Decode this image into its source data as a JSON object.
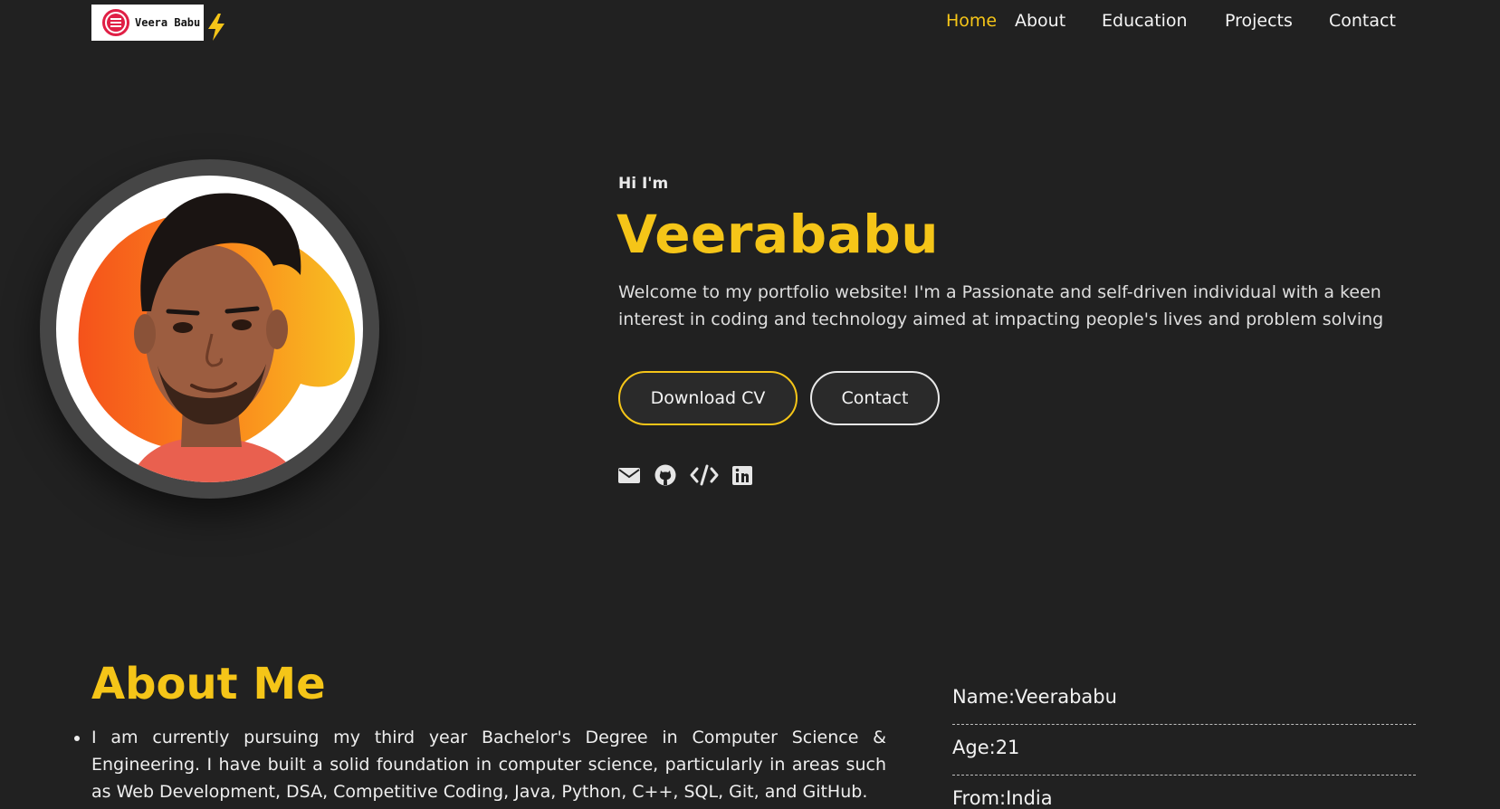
{
  "logo": {
    "text": "Veera Babu"
  },
  "nav": {
    "items": [
      {
        "label": "Home",
        "active": true
      },
      {
        "label": "About"
      },
      {
        "label": "Education"
      },
      {
        "label": "Projects"
      },
      {
        "label": "Contact"
      }
    ]
  },
  "hero": {
    "greeting": "Hi I'm",
    "name": "Veerababu",
    "description": "Welcome to my portfolio website! I'm a Passionate and self-driven individual with a keen interest in coding and technology aimed at impacting people's lives and problem solving",
    "buttons": {
      "download_cv": "Download CV",
      "contact": "Contact"
    },
    "socials": [
      "envelope-icon",
      "github-icon",
      "code-icon",
      "linkedin-icon"
    ]
  },
  "about": {
    "title": "About Me",
    "paragraph": "I am currently pursuing my third year Bachelor's Degree in Computer Science & Engineering. I have built a solid foundation in computer science, particularly in areas such as Web Development, DSA, Competitive Coding, Java, Python, C++, SQL, Git, and GitHub.",
    "info": {
      "name": "Name:Veerababu",
      "age": "Age:21",
      "from": "From:India"
    }
  },
  "colors": {
    "accent": "#f5c518",
    "background": "#212121",
    "logo_red": "#e01f45"
  }
}
